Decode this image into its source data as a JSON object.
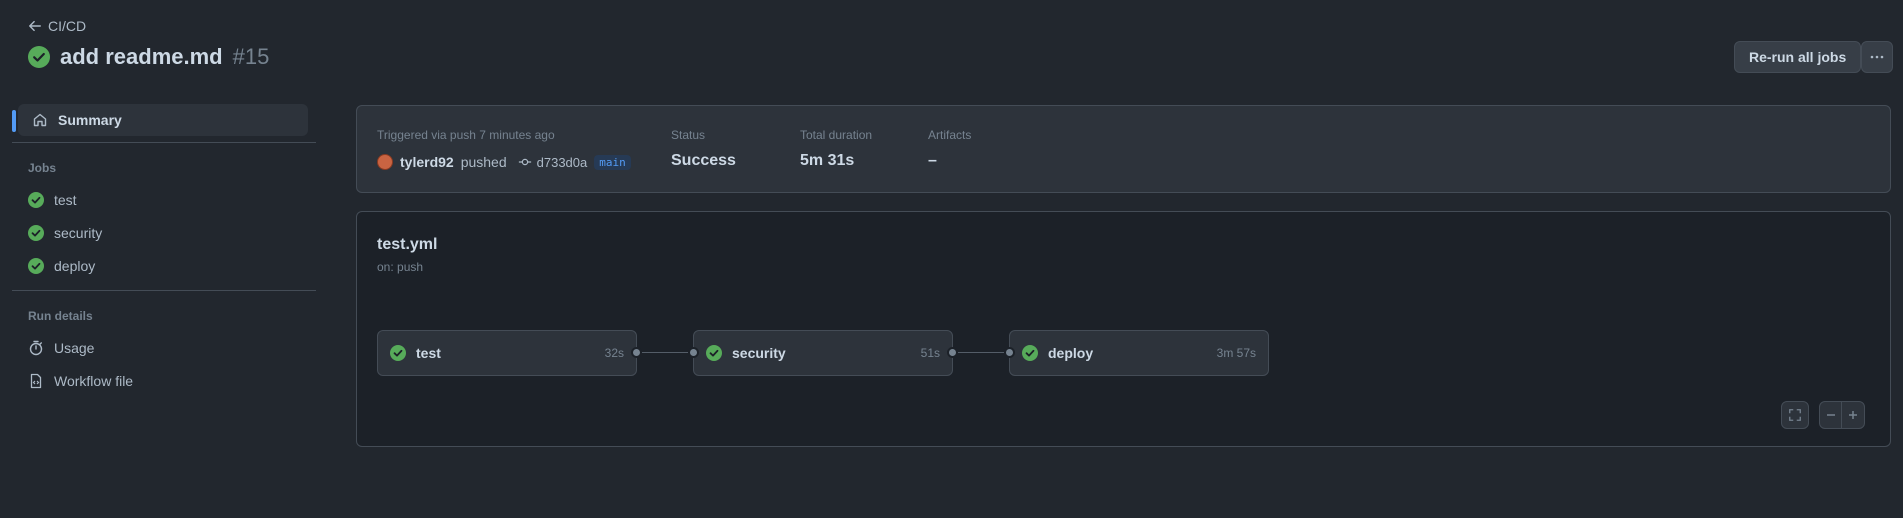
{
  "header": {
    "back_label": "CI/CD",
    "title": "add readme.md",
    "run_number": "#15",
    "rerun_label": "Re-run all jobs"
  },
  "sidebar": {
    "summary_label": "Summary",
    "jobs_heading": "Jobs",
    "jobs": [
      {
        "label": "test"
      },
      {
        "label": "security"
      },
      {
        "label": "deploy"
      }
    ],
    "run_details_heading": "Run details",
    "details": [
      {
        "label": "Usage",
        "icon": "stopwatch-icon"
      },
      {
        "label": "Workflow file",
        "icon": "file-code-icon"
      }
    ]
  },
  "summary": {
    "trigger_label": "Triggered via push 7 minutes ago",
    "actor": "tylerd92",
    "action": "pushed",
    "commit": "d733d0a",
    "branch": "main",
    "status_label": "Status",
    "status_value": "Success",
    "duration_label": "Total duration",
    "duration_value": "5m 31s",
    "artifacts_label": "Artifacts",
    "artifacts_value": "–"
  },
  "workflow": {
    "file": "test.yml",
    "trigger": "on: push",
    "jobs": [
      {
        "name": "test",
        "duration": "32s"
      },
      {
        "name": "security",
        "duration": "51s"
      },
      {
        "name": "deploy",
        "duration": "3m 57s"
      }
    ]
  },
  "colors": {
    "background": "#22272e",
    "success": "#57ab5a",
    "accent": "#539bf5"
  }
}
